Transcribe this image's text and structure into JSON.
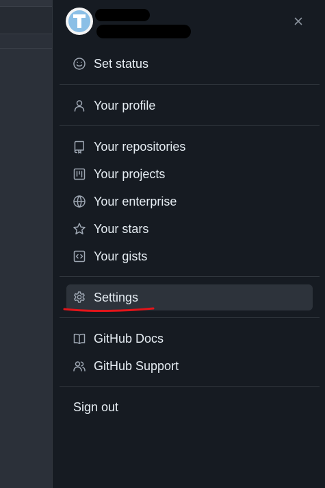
{
  "header": {
    "close_label": "×"
  },
  "menu": {
    "set_status": "Set status",
    "your_profile": "Your profile",
    "your_repositories": "Your repositories",
    "your_projects": "Your projects",
    "your_enterprise": "Your enterprise",
    "your_stars": "Your stars",
    "your_gists": "Your gists",
    "settings": "Settings",
    "github_docs": "GitHub Docs",
    "github_support": "GitHub Support",
    "sign_out": "Sign out"
  },
  "colors": {
    "panel_bg": "#161b22",
    "text": "#e6edf3",
    "icon": "#9ea7b3",
    "active_bg": "#2d333b",
    "annotation": "#e3151a"
  },
  "icons": {
    "set_status": "smiley-icon",
    "your_profile": "person-icon",
    "your_repositories": "repo-icon",
    "your_projects": "project-icon",
    "your_enterprise": "globe-icon",
    "your_stars": "star-icon",
    "your_gists": "code-square-icon",
    "settings": "gear-icon",
    "github_docs": "book-icon",
    "github_support": "people-icon"
  }
}
